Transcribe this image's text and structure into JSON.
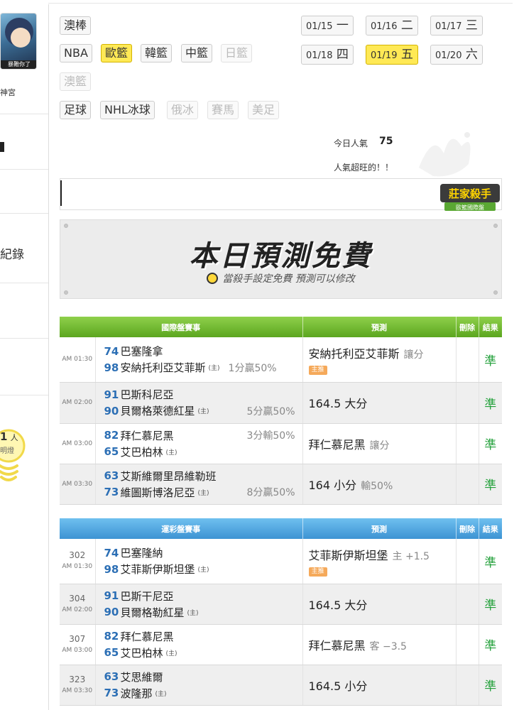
{
  "sidebar": {
    "avatar_caption": "暴難你了",
    "user_name": "神宮",
    "record_label": "紀錄",
    "count": "1",
    "count_unit": "人",
    "light_label": "明燈"
  },
  "sports": {
    "row1": [
      {
        "label": "澳棒",
        "state": "normal"
      }
    ],
    "row2": [
      {
        "label": "NBA",
        "state": "normal"
      },
      {
        "label": "歐籃",
        "state": "active"
      },
      {
        "label": "韓籃",
        "state": "normal"
      },
      {
        "label": "中籃",
        "state": "normal"
      },
      {
        "label": "日籃",
        "state": "disabled"
      }
    ],
    "row3": [
      {
        "label": "澳籃",
        "state": "disabled"
      }
    ],
    "row4": [
      {
        "label": "足球",
        "state": "normal"
      },
      {
        "label": "NHL冰球",
        "state": "normal"
      },
      {
        "label": "俄冰",
        "state": "disabled"
      },
      {
        "label": "賽馬",
        "state": "disabled"
      },
      {
        "label": "美足",
        "state": "disabled"
      }
    ]
  },
  "dates": [
    {
      "md": "01/15",
      "dow": "一",
      "active": false
    },
    {
      "md": "01/16",
      "dow": "二",
      "active": false
    },
    {
      "md": "01/17",
      "dow": "三",
      "active": false
    },
    {
      "md": "01/18",
      "dow": "四",
      "active": false
    },
    {
      "md": "01/19",
      "dow": "五",
      "active": true
    },
    {
      "md": "01/20",
      "dow": "六",
      "active": false
    }
  ],
  "popularity": {
    "label": "今日人氣",
    "value": "75",
    "text": "人氣超旺的！！"
  },
  "badge": {
    "title": "莊家殺手",
    "sub": "歐籃國際盤"
  },
  "free_banner": {
    "title": "本日預測免費",
    "sub": "當殺手設定免費 預測可以修改"
  },
  "intl_table": {
    "headers": [
      "國際盤賽事",
      "預測",
      "刪除",
      "結果"
    ],
    "rows": [
      {
        "time": "AM 01:30",
        "away_score": "74",
        "away": "巴塞隆拿",
        "away_odds": "",
        "home_score": "98",
        "home": "安納托利亞艾菲斯",
        "home_odds": "1分贏50%",
        "pred": "安納托利亞艾菲斯",
        "pred_sub": "讓分",
        "tag": "主推",
        "result": "準"
      },
      {
        "time": "AM 02:00",
        "away_score": "91",
        "away": "巴斯科尼亞",
        "away_odds": "",
        "home_score": "90",
        "home": "貝爾格萊德紅星",
        "home_odds": "5分贏50%",
        "pred": "164.5 大分",
        "pred_sub": "",
        "tag": "",
        "result": "準"
      },
      {
        "time": "AM 03:00",
        "away_score": "82",
        "away": "拜仁慕尼黑",
        "away_odds": "3分輸50%",
        "home_score": "65",
        "home": "艾巴柏林",
        "home_odds": "",
        "pred": "拜仁慕尼黑",
        "pred_sub": "讓分",
        "tag": "",
        "result": "準"
      },
      {
        "time": "AM 03:30",
        "away_score": "63",
        "away": "艾斯維爾里昂維勒班",
        "away_odds": "",
        "home_score": "73",
        "home": "維圖斯博洛尼亞",
        "home_odds": "8分贏50%",
        "pred": "164 小分",
        "pred_sub": "輸50%",
        "tag": "",
        "result": "準"
      }
    ]
  },
  "lottery_table": {
    "headers": [
      "運彩盤賽事",
      "預測",
      "刪除",
      "結果"
    ],
    "rows": [
      {
        "num": "302",
        "time": "AM 01:30",
        "away_score": "74",
        "away": "巴塞隆納",
        "home_score": "98",
        "home": "艾菲斯伊斯坦堡",
        "pred": "艾菲斯伊斯坦堡",
        "pred_sub": "主 +1.5",
        "tag": "主推",
        "result": "準"
      },
      {
        "num": "304",
        "time": "AM 02:00",
        "away_score": "91",
        "away": "巴斯干尼亞",
        "home_score": "90",
        "home": "貝爾格勒紅星",
        "pred": "164.5 大分",
        "pred_sub": "",
        "tag": "",
        "result": "準"
      },
      {
        "num": "307",
        "time": "AM 03:00",
        "away_score": "82",
        "away": "拜仁慕尼黑",
        "home_score": "65",
        "home": "艾巴柏林",
        "pred": "拜仁慕尼黑",
        "pred_sub": "客 −3.5",
        "tag": "",
        "result": "準"
      },
      {
        "num": "323",
        "time": "AM 03:30",
        "away_score": "63",
        "away": "艾思維爾",
        "home_score": "73",
        "home": "波隆那",
        "pred": "164.5 小分",
        "pred_sub": "",
        "tag": "",
        "result": "準"
      }
    ]
  },
  "home_mark": "(主)",
  "colors": {
    "accent_yellow": "#ffe955",
    "green_header": "#5ba61f",
    "blue_header": "#3d93d3",
    "score_blue": "#2c6fb5",
    "result_green": "#22a03a"
  }
}
